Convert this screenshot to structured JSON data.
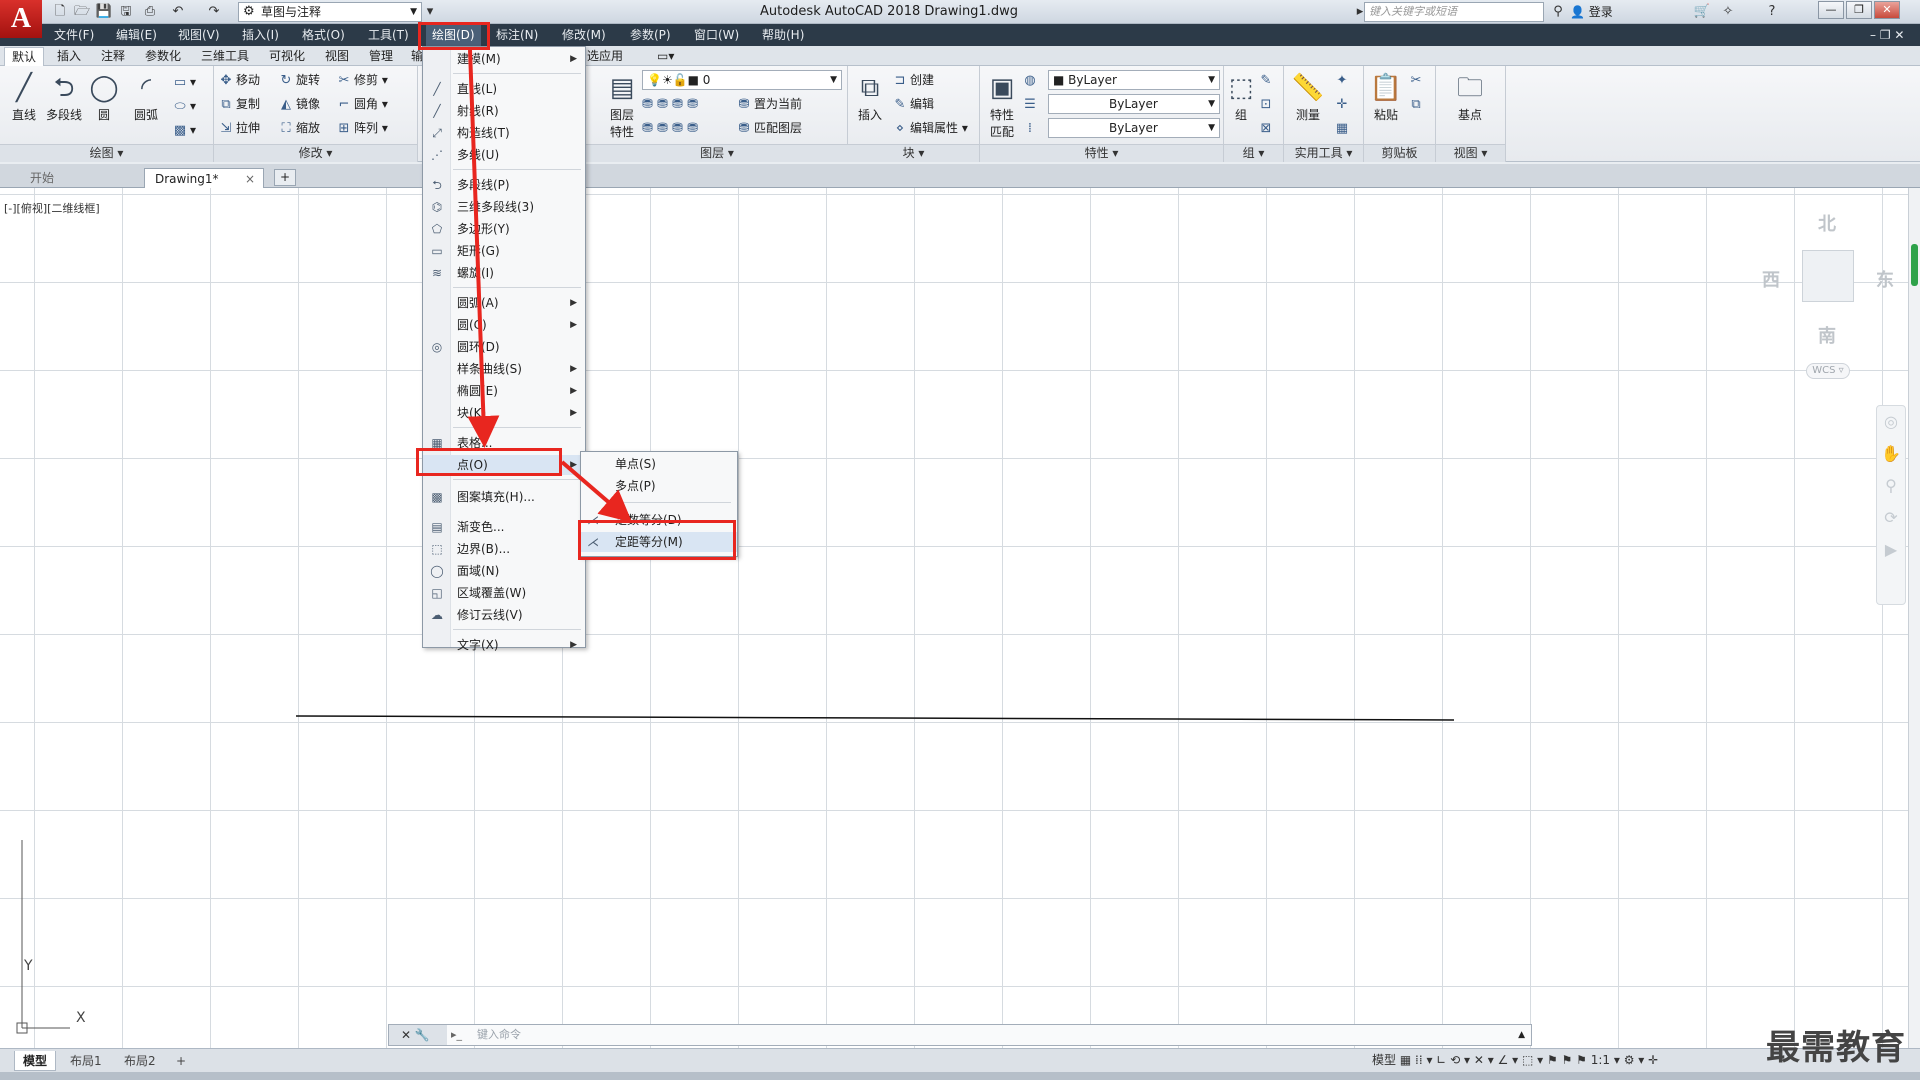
{
  "titlebar": {
    "app_logo": "A",
    "workspace": "草图与注释",
    "title": "Autodesk AutoCAD 2018    Drawing1.dwg",
    "search_placeholder": "键入关键字或短语",
    "login": "登录",
    "help": "?",
    "minimize": "—",
    "restore": "❐",
    "close": "✕"
  },
  "menubar": {
    "items": [
      "文件(F)",
      "编辑(E)",
      "视图(V)",
      "插入(I)",
      "格式(O)",
      "工具(T)",
      "绘图(D)",
      "标注(N)",
      "修改(M)",
      "参数(P)",
      "窗口(W)",
      "帮助(H)"
    ],
    "active_index": 6
  },
  "ribbon_tabs": [
    "默认",
    "插入",
    "注释",
    "参数化",
    "三维工具",
    "可视化",
    "视图",
    "管理",
    "输",
    "选应用"
  ],
  "ribbon": {
    "draw_panel": {
      "title": "绘图 ▾",
      "tools": [
        "直线",
        "多段线",
        "圆",
        "圆弧"
      ]
    },
    "modify_panel": {
      "title": "修改 ▾",
      "tools": [
        "移动",
        "旋转",
        "修剪 ▾",
        "复制",
        "镜像",
        "圆角 ▾",
        "拉伸",
        "缩放",
        "阵列 ▾"
      ]
    },
    "layers_panel": {
      "title": "图层 ▾",
      "big_tool": "图层\n特性",
      "layer_value": "0",
      "tools": [
        "置为当前",
        "匹配图层"
      ]
    },
    "block_panel": {
      "title": "块 ▾",
      "big_tool": "插入",
      "tools": [
        "创建",
        "编辑",
        "编辑属性 ▾"
      ]
    },
    "properties_panel": {
      "title": "特性 ▾",
      "big_tool": "特性\n匹配",
      "color": "ByLayer",
      "linetype": "ByLayer",
      "lineweight": "ByLayer"
    },
    "group_panel": {
      "title": "组 ▾",
      "big_tool": "组"
    },
    "utilities_panel": {
      "title": "实用工具 ▾",
      "big_tool": "测量"
    },
    "clipboard_panel": {
      "title": "剪贴板",
      "big_tool": "粘贴"
    },
    "view_panel": {
      "title": "视图 ▾",
      "big_tool": "基点"
    }
  },
  "doc_tabs": {
    "start": "开始",
    "active": "Drawing1*",
    "close": "×",
    "add": "+"
  },
  "viewport_label": "[-][俯视][二维线框]",
  "viewcube": {
    "north": "北",
    "south": "南",
    "east": "东",
    "west": "西",
    "wcs": "WCS ▿"
  },
  "ucs": {
    "x": "X",
    "y": "Y"
  },
  "draw_menu": {
    "items": [
      {
        "label": "建模(M)",
        "icon": "",
        "submenu": true
      },
      {
        "label": "直线(L)",
        "icon": "╱",
        "submenu": false
      },
      {
        "label": "射线(R)",
        "icon": "╱",
        "submenu": false
      },
      {
        "label": "构造线(T)",
        "icon": "⤢",
        "submenu": false
      },
      {
        "label": "多线(U)",
        "icon": "⋰",
        "submenu": false
      },
      {
        "label": "多段线(P)",
        "icon": "⮌",
        "submenu": false
      },
      {
        "label": "三维多段线(3)",
        "icon": "⌬",
        "submenu": false
      },
      {
        "label": "多边形(Y)",
        "icon": "⬠",
        "submenu": false
      },
      {
        "label": "矩形(G)",
        "icon": "▭",
        "submenu": false
      },
      {
        "label": "螺旋(I)",
        "icon": "≋",
        "submenu": false
      },
      {
        "label": "圆弧(A)",
        "icon": "",
        "submenu": true
      },
      {
        "label": "圆(C)",
        "icon": "",
        "submenu": true
      },
      {
        "label": "圆环(D)",
        "icon": "◎",
        "submenu": false
      },
      {
        "label": "样条曲线(S)",
        "icon": "",
        "submenu": true
      },
      {
        "label": "椭圆(E)",
        "icon": "",
        "submenu": true
      },
      {
        "label": "块(K)",
        "icon": "",
        "submenu": true
      },
      {
        "label": "表格...",
        "icon": "▦",
        "submenu": false
      },
      {
        "label": "点(O)",
        "icon": "",
        "submenu": true
      },
      {
        "label": "图案填充(H)...",
        "icon": "▩",
        "submenu": false
      },
      {
        "label": "渐变色...",
        "icon": "▤",
        "submenu": false
      },
      {
        "label": "边界(B)...",
        "icon": "⬚",
        "submenu": false
      },
      {
        "label": "面域(N)",
        "icon": "◯",
        "submenu": false
      },
      {
        "label": "区域覆盖(W)",
        "icon": "◱",
        "submenu": false
      },
      {
        "label": "修订云线(V)",
        "icon": "☁",
        "submenu": false
      },
      {
        "label": "文字(X)",
        "icon": "",
        "submenu": true
      }
    ]
  },
  "point_submenu": {
    "items": [
      {
        "label": "单点(S)",
        "icon": ""
      },
      {
        "label": "多点(P)",
        "icon": ""
      },
      {
        "label": "定数等分(D)",
        "icon": "⋌"
      },
      {
        "label": "定距等分(M)",
        "icon": "⋌"
      }
    ]
  },
  "cmdline": {
    "left_icons": "✕  🔧",
    "prompt_icon": "▸_",
    "placeholder": "键入命令"
  },
  "layout_tabs": [
    "模型",
    "布局1",
    "布局2",
    "+"
  ],
  "status": {
    "model": "模型",
    "scale": "1:1"
  },
  "watermark": "最需教育",
  "colors": {
    "menubar_bg": "#2c3a48",
    "highlight_red": "#e8261f",
    "logo_red": "#c8201c",
    "scroll_green": "#2ea24a"
  }
}
